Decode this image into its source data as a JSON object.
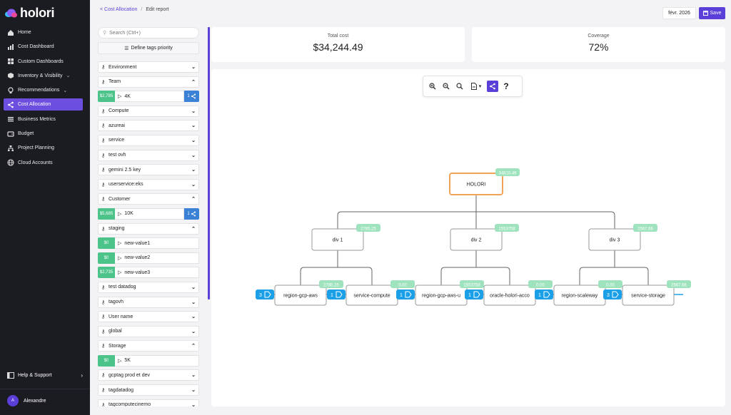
{
  "app": {
    "name": "holori"
  },
  "nav": [
    {
      "label": "Home",
      "icon": "home-icon"
    },
    {
      "label": "Cost Dashboard",
      "icon": "bar-chart-icon"
    },
    {
      "label": "Custom Dashboards",
      "icon": "grid-icon"
    },
    {
      "label": "Inventory & Visibility",
      "icon": "cube-icon",
      "expandable": true
    },
    {
      "label": "Recommendations",
      "icon": "lightbulb-icon",
      "expandable": true
    },
    {
      "label": "Cost Allocation",
      "icon": "share-icon",
      "active": true
    },
    {
      "label": "Business Metrics",
      "icon": "list-icon"
    },
    {
      "label": "Budget",
      "icon": "wallet-icon"
    },
    {
      "label": "Project Planning",
      "icon": "sitemap-icon"
    },
    {
      "label": "Cloud Accounts",
      "icon": "globe-icon"
    }
  ],
  "help": {
    "label": "Help & Support"
  },
  "user": {
    "name": "Alexandre",
    "initial": "A"
  },
  "breadcrumb": {
    "parent": "Cost Allocation",
    "current": "Edit report"
  },
  "header": {
    "date": "févr. 2026",
    "save_label": "Save"
  },
  "search": {
    "placeholder": "Search (Ctrl+)"
  },
  "define_tags": {
    "label": "Define tags priority"
  },
  "tags": [
    {
      "type": "tag",
      "label": "Environment",
      "expanded": false
    },
    {
      "type": "tag",
      "label": "Team",
      "expanded": true
    },
    {
      "type": "value",
      "cost": "$2,785",
      "label": "4K",
      "count": "1"
    },
    {
      "type": "tag",
      "label": "Compute",
      "expanded": false
    },
    {
      "type": "tag",
      "label": "azureai",
      "expanded": false
    },
    {
      "type": "tag",
      "label": "service",
      "expanded": false
    },
    {
      "type": "tag",
      "label": "test ovh",
      "expanded": false
    },
    {
      "type": "tag",
      "label": "gemini 2.5 key",
      "expanded": false
    },
    {
      "type": "tag",
      "label": "userservice:eks",
      "expanded": false
    },
    {
      "type": "tag",
      "label": "Customer",
      "expanded": true
    },
    {
      "type": "value",
      "cost": "$5,685",
      "label": "10K",
      "count": "1"
    },
    {
      "type": "tag",
      "label": "staging",
      "expanded": true
    },
    {
      "type": "value",
      "cost": "$0",
      "label": "new-value1"
    },
    {
      "type": "value",
      "cost": "$0",
      "label": "new-value2"
    },
    {
      "type": "value",
      "cost": "$2,735",
      "label": "new-value3"
    },
    {
      "type": "tag",
      "label": "test datadog",
      "expanded": false
    },
    {
      "type": "tag",
      "label": "tagovh",
      "expanded": false
    },
    {
      "type": "tag",
      "label": "User name",
      "expanded": false
    },
    {
      "type": "tag",
      "label": "global",
      "expanded": false
    },
    {
      "type": "tag",
      "label": "Storage",
      "expanded": true
    },
    {
      "type": "value",
      "cost": "$0",
      "label": "5K"
    },
    {
      "type": "tag",
      "label": "gcptag prod et dev",
      "expanded": false
    },
    {
      "type": "tag",
      "label": "tagdatadog",
      "expanded": false
    },
    {
      "type": "tag",
      "label": "tagcomputecinemo",
      "expanded": false
    }
  ],
  "cards": {
    "total_cost": {
      "label": "Total cost",
      "value": "$34,244.49"
    },
    "coverage": {
      "label": "Coverage",
      "value": "72%"
    }
  },
  "toolbar": {
    "buttons": [
      "zoom-in-icon",
      "zoom-out-icon",
      "zoom-reset-icon",
      "export-icon",
      "share-icon",
      "help-icon"
    ]
  },
  "tree": {
    "root": {
      "label": "HOLORI",
      "value": "34810.49"
    },
    "divisions": [
      {
        "label": "div 1",
        "value": "2785.25"
      },
      {
        "label": "div 2",
        "value": "1553758"
      },
      {
        "label": "div 3",
        "value": "2567.66"
      }
    ],
    "leaves": [
      {
        "label": "region-gcp-aws",
        "value": "2785.25",
        "badge": "3"
      },
      {
        "label": "service-compute",
        "value": "0.00",
        "badge": "1"
      },
      {
        "label": "region-gcp-aws-u",
        "value": "1553758",
        "badge": "1"
      },
      {
        "label": "oracle-holori-acco",
        "value": "0.00",
        "badge": "1"
      },
      {
        "label": "region-scaleway",
        "value": "0.00",
        "badge": "1"
      },
      {
        "label": "service-storage",
        "value": "2567.66",
        "badge": "3"
      }
    ]
  },
  "colors": {
    "accent": "#5b3fd8",
    "cost_badge": "#4cc389",
    "share_blue": "#3b82d6",
    "node_value": "#9ee3bd",
    "tree_badge": "#1ba0e8",
    "root_border": "#f0a45a"
  }
}
